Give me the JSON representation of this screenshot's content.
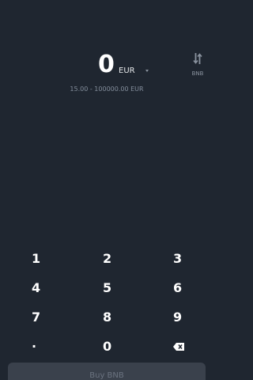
{
  "amount": {
    "value": "0",
    "currency": "EUR"
  },
  "swap": {
    "label": "BNB",
    "icon": "swap-vertical-icon"
  },
  "range": {
    "text": "15.00 - 100000.00 EUR"
  },
  "keypad": {
    "keys": [
      "1",
      "2",
      "3",
      "4",
      "5",
      "6",
      "7",
      "8",
      "9",
      "·",
      "0"
    ],
    "delete_icon": "backspace-icon"
  },
  "buy_button": {
    "label": "Buy BNB"
  },
  "colors": {
    "background": "#1f2630",
    "button_disabled": "#3a414c",
    "muted_text": "#848e9c"
  }
}
